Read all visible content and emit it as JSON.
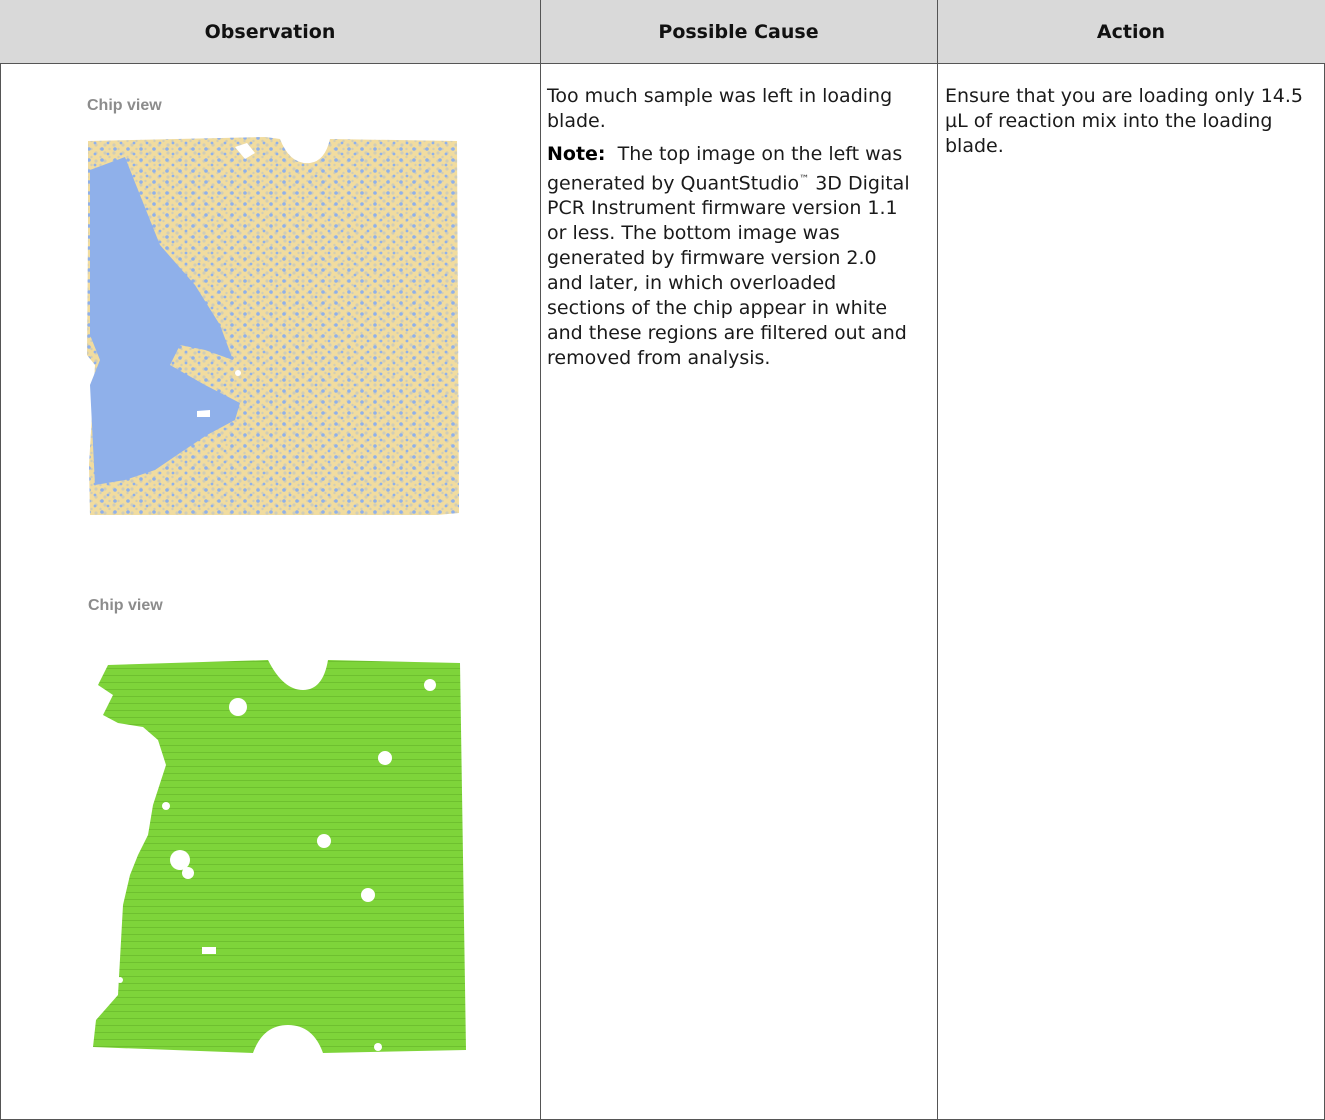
{
  "table": {
    "headers": {
      "observation": "Observation",
      "cause": "Possible Cause",
      "action": "Action"
    },
    "observation": {
      "top_chip_label": "Chip view",
      "bottom_chip_label": "Chip view"
    },
    "cause": {
      "main": "Too much sample was left in loading blade.",
      "note_label": "Note:",
      "note_part1": "The top image on the left was generated by QuantStudio",
      "tm": "™",
      "note_part2": "3D Digital PCR Instrument firmware version 1.1 or less. The bottom image was generated by firmware version 2.0 and later, in which overloaded sections of the chip appear in white and these regions are filtered out and removed from analysis."
    },
    "action": {
      "text": "Ensure that you are loading only 14.5 µL of reaction mix into the loading blade."
    }
  },
  "colors": {
    "header_bg": "#d9d9d9",
    "chip_top_bg": "#f1dc9f",
    "chip_top_dots": "#8fb0ea",
    "chip_bottom": "#7ed43a"
  }
}
